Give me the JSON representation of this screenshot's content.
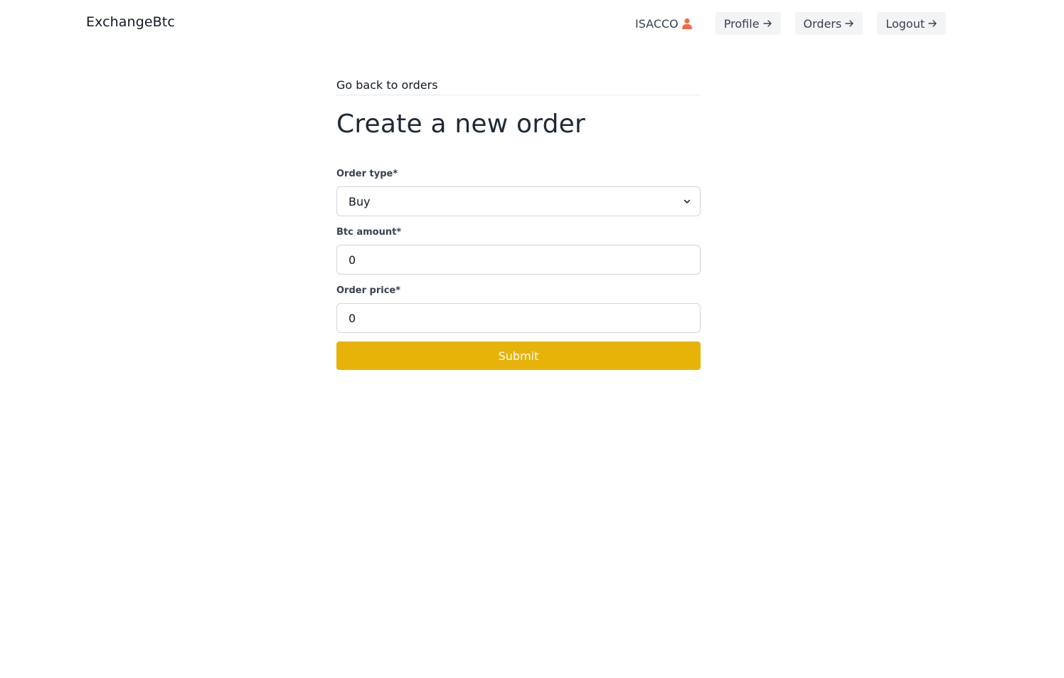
{
  "navbar": {
    "brand": "ExchangeBtc",
    "username": "ISACCO",
    "user_icon": "user-icon",
    "links": [
      {
        "label": "Profile",
        "icon": "arrow-right-icon"
      },
      {
        "label": "Orders",
        "icon": "arrow-right-icon"
      },
      {
        "label": "Logout",
        "icon": "arrow-right-icon"
      }
    ],
    "user_icon_color": "#ef6c4a"
  },
  "main": {
    "back_link": "Go back to orders",
    "title": "Create a new order",
    "form": {
      "order_type": {
        "label": "Order type*",
        "value": "Buy"
      },
      "btc_amount": {
        "label": "Btc amount*",
        "value": "0"
      },
      "order_price": {
        "label": "Order price*",
        "value": "0"
      },
      "submit_label": "Submit"
    },
    "accent_color": "#e8b308"
  }
}
